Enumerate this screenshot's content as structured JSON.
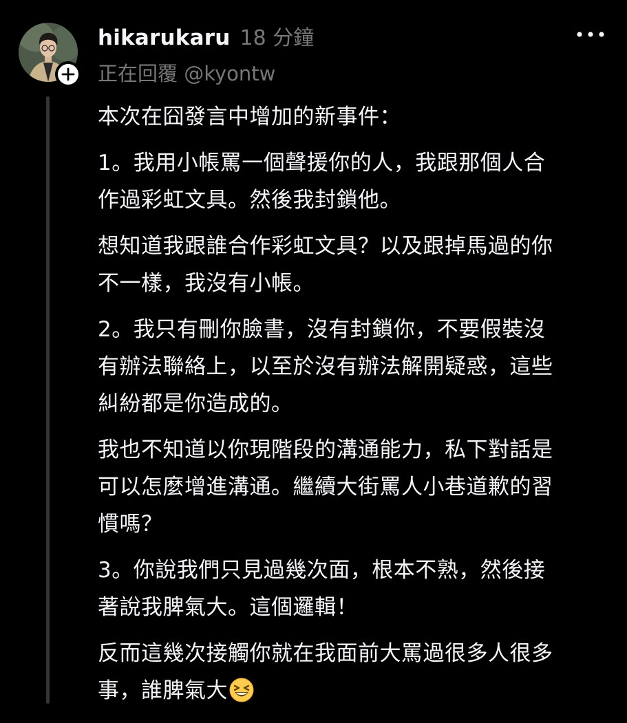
{
  "post": {
    "username": "hikarukaru",
    "timestamp": "18 分鐘",
    "replying_prefix": "正在回覆",
    "replying_handle": "@kyontw",
    "paragraphs": [
      [
        "本次在囧發言中增加的新事件："
      ],
      [
        "1。我用小帳罵一個聲援你的人，我跟那個人合",
        "作過彩虹文具。然後我封鎖他。"
      ],
      [
        "想知道我跟誰合作彩虹文具？以及跟掉馬過的你",
        "不一樣，我沒有小帳。"
      ],
      [
        "2。我只有刪你臉書，沒有封鎖你，不要假裝沒",
        "有辦法聯絡上，以至於沒有辦法解開疑惑，這些",
        "糾紛都是你造成的。"
      ],
      [
        "我也不知道以你現階段的溝通能力，私下對話是",
        "可以怎麼增進溝通。繼續大街罵人小巷道歉的習",
        "慣嗎？"
      ],
      [
        "3。你說我們只見過幾次面，根本不熟，然後接",
        "著說我脾氣大。這個邏輯！"
      ],
      [
        "反而這幾次接觸你就在我面前大罵過很多人很多",
        "事，誰脾氣大"
      ]
    ],
    "trailing_emoji": "grinning-squinting-face-emoji"
  },
  "icons": {
    "more": "more-horizontal-icon",
    "follow": "plus-icon",
    "avatar": "profile-photo"
  },
  "colors": {
    "background": "#000000",
    "text_primary": "#f3f5f7",
    "text_secondary": "#777777",
    "thread_line": "#333638"
  }
}
